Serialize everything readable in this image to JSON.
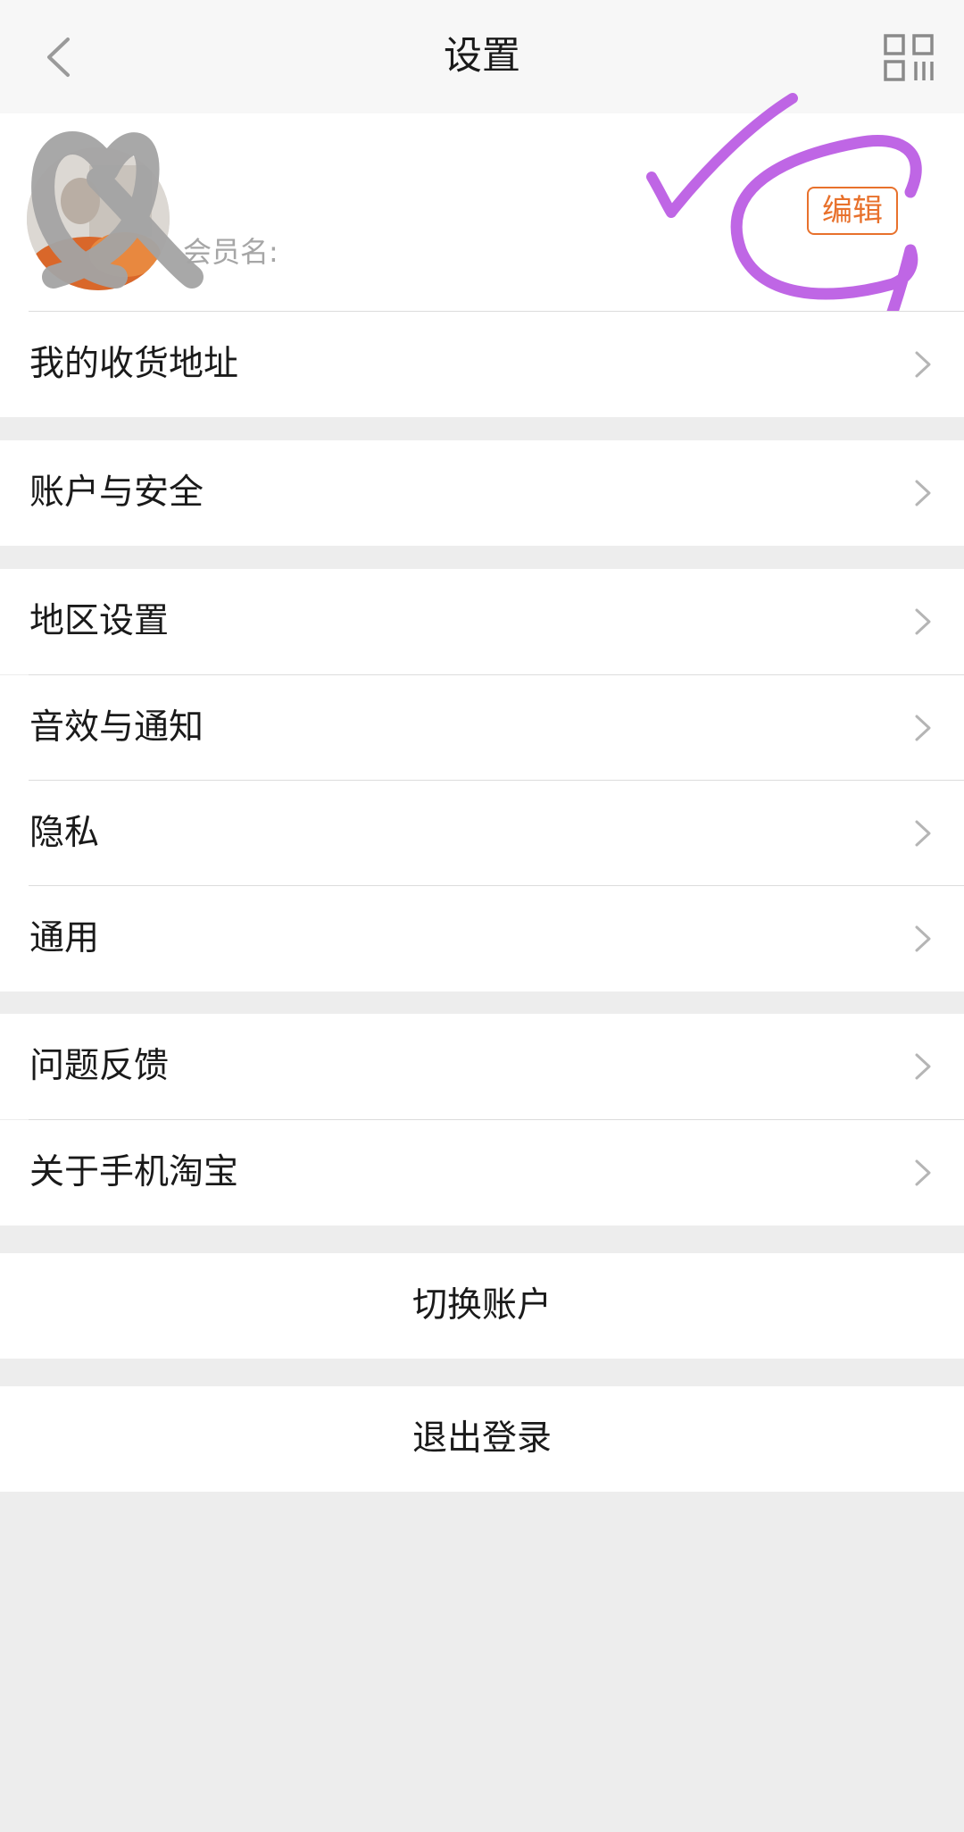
{
  "header": {
    "title": "设置",
    "back_icon": "back-chevron-icon",
    "qr_icon": "qr-code-icon"
  },
  "profile": {
    "member_label": "会员名:",
    "edit_label": "编辑",
    "accent_color": "#e8712c"
  },
  "menu": {
    "address": "我的收货地址",
    "account_security": "账户与安全",
    "region": "地区设置",
    "sound_notify": "音效与通知",
    "privacy": "隐私",
    "general": "通用",
    "feedback": "问题反馈",
    "about": "关于手机淘宝"
  },
  "actions": {
    "switch_account": "切换账户",
    "logout": "退出登录"
  }
}
